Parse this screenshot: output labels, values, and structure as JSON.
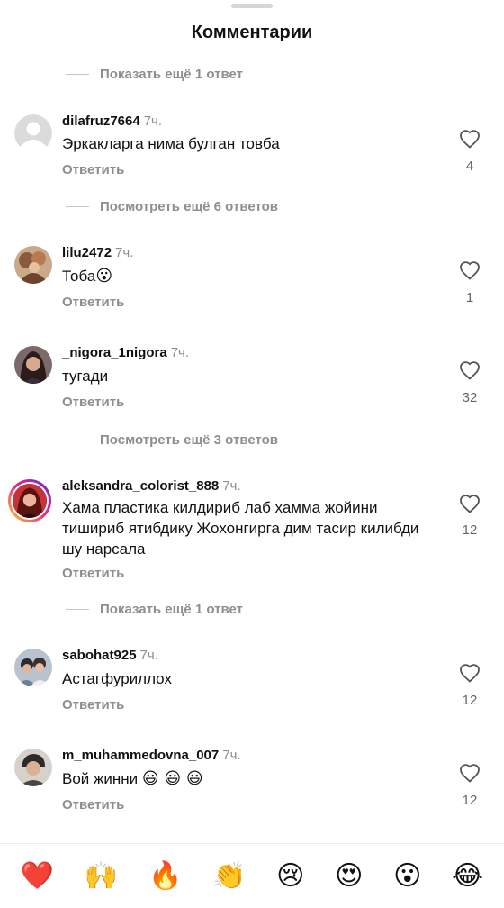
{
  "header": {
    "title": "Комментарии"
  },
  "threads": {
    "t0": "Показать ещё 1 ответ",
    "t1": "Посмотреть ещё 6 ответов",
    "t2": "Посмотреть ещё 3 ответов",
    "t3": "Показать ещё 1 ответ"
  },
  "comments": [
    {
      "user": "dilafruz7664",
      "time": "7ч.",
      "text": "Эркакларга нима булган товба",
      "reply": "Ответить",
      "likes": "4"
    },
    {
      "user": "lilu2472",
      "time": "7ч.",
      "text": "Тоба",
      "emoji": "😮",
      "reply": "Ответить",
      "likes": "1"
    },
    {
      "user": "_nigora_1nigora",
      "time": "7ч.",
      "text": "тугади",
      "reply": "Ответить",
      "likes": "32"
    },
    {
      "user": "aleksandra_colorist_888",
      "time": "7ч.",
      "text": "Хама пластика килдириб лаб хамма жойини тишириб ятибдику Жохонгирга дим тасир килибди шу нарсала",
      "reply": "Ответить",
      "likes": "12"
    },
    {
      "user": "sabohat925",
      "time": "7ч.",
      "text": "Астагфуриллох",
      "reply": "Ответить",
      "likes": "12"
    },
    {
      "user": "m_muhammedovna_007",
      "time": "7ч.",
      "text": "Вой жинни",
      "emoji": "😃 😃 😃",
      "reply": "Ответить",
      "likes": "12"
    }
  ],
  "emoji_bar": [
    "❤️",
    "🙌",
    "🔥",
    "👏",
    "😢",
    "😍",
    "😮",
    "😂"
  ],
  "icons": {
    "like": "heart-outline-icon",
    "default_avatar": "default-avatar-icon"
  },
  "colors": {
    "secondary_text": "#8e8e8e",
    "story_ring": "#ee2a7b"
  }
}
